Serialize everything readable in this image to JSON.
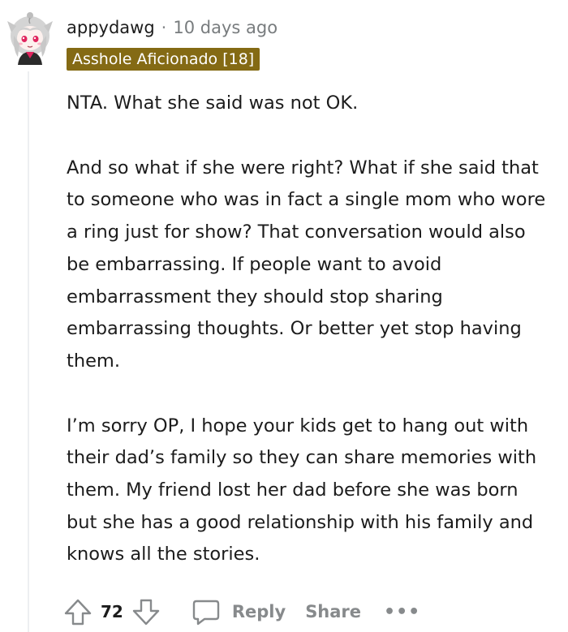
{
  "comment": {
    "avatar": "anime-avatar-icon",
    "username": "appydawg",
    "separator": "·",
    "timestamp": "10 days ago",
    "flair": "Asshole Aficionado [18]",
    "paragraphs": [
      "NTA. What she said was not OK.",
      "And so what if she were right? What if she said that to someone who was in fact a single mom who wore a ring just for show? That conversation would also be embarrassing. If people want to avoid embarrassment they should stop sharing embarrassing thoughts. Or better yet stop having them.",
      "I’m sorry OP, I hope your kids get to hang out with their dad’s family so they can share memories with them. My friend lost her dad before she was born but she has a good relationship with his family and knows all the stories."
    ],
    "actions": {
      "score": "72",
      "reply_label": "Reply",
      "share_label": "Share",
      "more_label": "•••"
    }
  },
  "colors": {
    "flair_bg": "#846a14",
    "muted_text": "#878a8c",
    "thread_line": "#edeff1"
  }
}
